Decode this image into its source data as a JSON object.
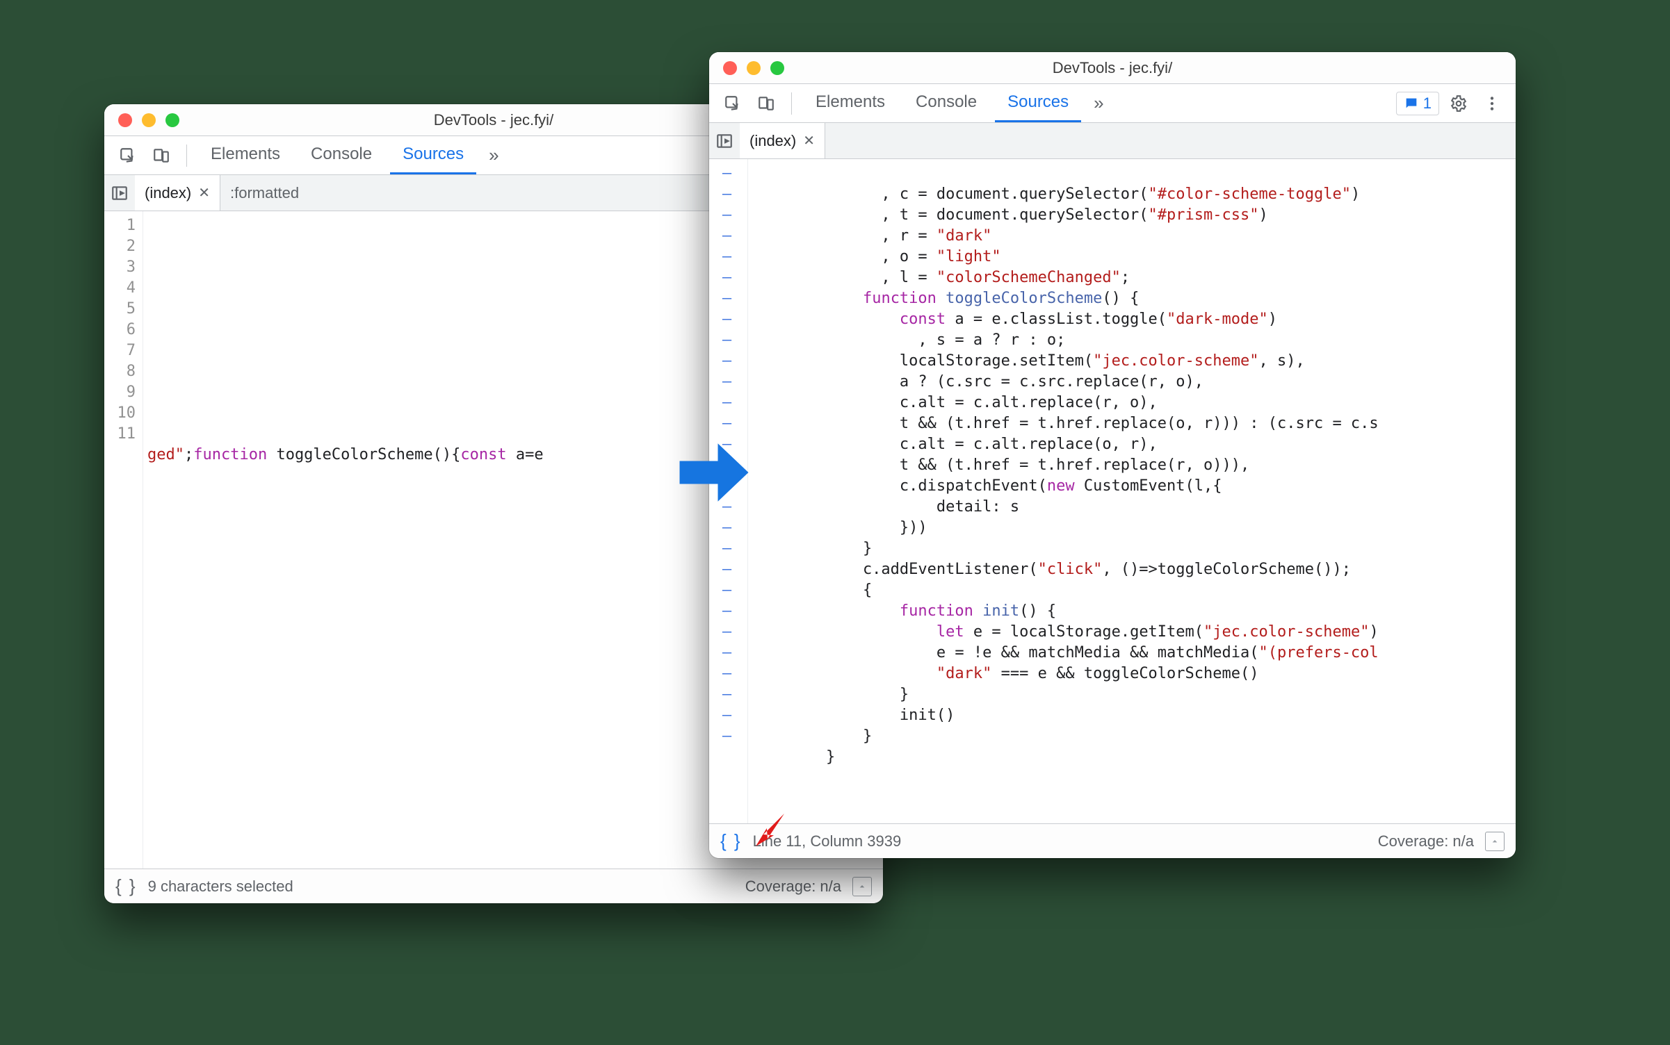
{
  "left": {
    "title": "DevTools - jec.fyi/",
    "tabs": {
      "elements": "Elements",
      "console": "Console",
      "sources": "Sources"
    },
    "file_tabs": {
      "index": "(index)",
      "formatted": ":formatted"
    },
    "gutter": [
      "1",
      "2",
      "3",
      "4",
      "5",
      "6",
      "7",
      "8",
      "9",
      "10",
      "11"
    ],
    "code_line11_a": "ged\"",
    "code_line11_b": ";",
    "code_line11_c": "function",
    "code_line11_d": " toggleColorScheme(){",
    "code_line11_e": "const",
    "code_line11_f": " a=e",
    "status": {
      "info": "9 characters selected",
      "coverage": "Coverage: n/a"
    }
  },
  "right": {
    "title": "DevTools - jec.fyi/",
    "tabs": {
      "elements": "Elements",
      "console": "Console",
      "sources": "Sources"
    },
    "badge_count": "1",
    "file_tabs": {
      "index": "(index)"
    },
    "status": {
      "info": "Line 11, Column 3939",
      "coverage": "Coverage: n/a"
    },
    "code": {
      "l1": {
        "a": "              , c = document.querySelector(",
        "b": "\"#color-scheme-toggle\"",
        "c": ")"
      },
      "l2": {
        "a": "              , t = document.querySelector(",
        "b": "\"#prism-css\"",
        "c": ")"
      },
      "l3": {
        "a": "              , r = ",
        "b": "\"dark\""
      },
      "l4": {
        "a": "              , o = ",
        "b": "\"light\""
      },
      "l5": {
        "a": "              , l = ",
        "b": "\"colorSchemeChanged\"",
        "c": ";"
      },
      "l6": {
        "a": "            ",
        "kw": "function",
        "b": " ",
        "fn": "toggleColorScheme",
        "c": "() {"
      },
      "l7": {
        "a": "                ",
        "kw": "const",
        "b": " a = e.classList.toggle(",
        "str": "\"dark-mode\"",
        "c": ")"
      },
      "l8": "                  , s = a ? r : o;",
      "l9": {
        "a": "                localStorage.setItem(",
        "str": "\"jec.color-scheme\"",
        "b": ", s),"
      },
      "l10": "                a ? (c.src = c.src.replace(r, o),",
      "l11": "                c.alt = c.alt.replace(r, o),",
      "l12": "                t && (t.href = t.href.replace(o, r))) : (c.src = c.s",
      "l13": "                c.alt = c.alt.replace(o, r),",
      "l14": "                t && (t.href = t.href.replace(r, o))),",
      "l15": {
        "a": "                c.dispatchEvent(",
        "kw": "new",
        "b": " CustomEvent(l,{"
      },
      "l16": "                    detail: s",
      "l17": "                }))",
      "l18": "            }",
      "l19": {
        "a": "            c.addEventListener(",
        "str": "\"click\"",
        "b": ", ()=>toggleColorScheme());"
      },
      "l20": "            {",
      "l21": {
        "a": "                ",
        "kw": "function",
        "b": " ",
        "fn": "init",
        "c": "() {"
      },
      "l22": {
        "a": "                    ",
        "kw": "let",
        "b": " e = localStorage.getItem(",
        "str": "\"jec.color-scheme\"",
        "c": ")"
      },
      "l23": {
        "a": "                    e = !e && matchMedia && matchMedia(",
        "str": "\"(prefers-col"
      },
      "l24": {
        "a": "                    ",
        "str": "\"dark\"",
        "b": " === e && toggleColorScheme()"
      },
      "l25": "                }",
      "l26": "                init()",
      "l27": "            }",
      "l28": "        }"
    }
  }
}
